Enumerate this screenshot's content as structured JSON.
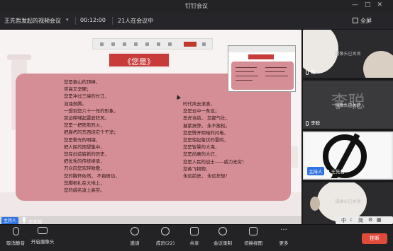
{
  "window": {
    "title": "钉钉会议"
  },
  "infobar": {
    "meeting_name": "王先哲发起的视频会议",
    "elapsed": "00:12:00",
    "participants": "21人在会议中",
    "fullscreen_label": "全屏"
  },
  "slide": {
    "title": "《您是》",
    "left_column": [
      "您是泰山的顶峰，",
      "崇高又坚硬；",
      "您是冲过三峡的长江，",
      "汹涌奔腾。",
      "一想到您六十一年的形象，",
      "耳边呼啸起雷庭狂风，",
      "您是一把熊熊烈火，",
      "把腐朽的东西烧它个干净；",
      "您是黎光的明镜，",
      "把人民的期望集中，",
      "您在创造崭新的历史，",
      "把优秀的传统继承，",
      "万众向您欢呼致敬，",
      "您的胸怀依然，  不自居功，",
      "您脚根扎在大地上，",
      "您的威名凌上高空。"
    ],
    "right_column": [
      "时代风云滚滚，",
      "您是云中一条龙；",
      "恶虎当前，  您都气壮，",
      "摧紫扶弊，  永不放松。",
      "您是劈开阴暗的闪电，",
      "您是惊起蛰伏的雷鸣，",
      "您是智慧的大海，",
      "您是尚惠的大灯，",
      "您是人民的战士——威力无穷！",
      "您英飞物物，",
      "永远前进，  永远年轻！"
    ]
  },
  "main_video": {
    "host_badge": "主持人",
    "speaker_name": "王先哲"
  },
  "sidebar": {
    "tiles": [
      {
        "camera_status": "摄像头已关闭",
        "name": "我"
      },
      {
        "camera_status": "摄像头已关闭",
        "avatar_text": "李聪",
        "name": "李聪"
      },
      {
        "host_badge": "主持人",
        "name": "王先哲"
      },
      {
        "camera_status": "摄像头已关闭"
      }
    ],
    "controls": [
      "中",
      "简"
    ]
  },
  "toolbar": {
    "items": [
      {
        "label": "取消静音",
        "icon": "mic-off-icon"
      },
      {
        "label": "开启摄像头",
        "icon": "camera-off-icon"
      },
      {
        "label": "邀请",
        "icon": "invite-icon"
      },
      {
        "label": "成员(22)",
        "icon": "members-icon"
      },
      {
        "label": "共享",
        "icon": "share-icon"
      },
      {
        "label": "会议录制",
        "icon": "record-icon"
      },
      {
        "label": "切换视图",
        "icon": "view-icon"
      },
      {
        "label": "更多",
        "icon": "more-icon"
      }
    ],
    "end_label": "挂断",
    "end_color": "#e04a3b"
  },
  "colors": {
    "accent": "#2f74e0",
    "slide_red": "#c73b3b",
    "slide_pink": "#d58e95"
  }
}
